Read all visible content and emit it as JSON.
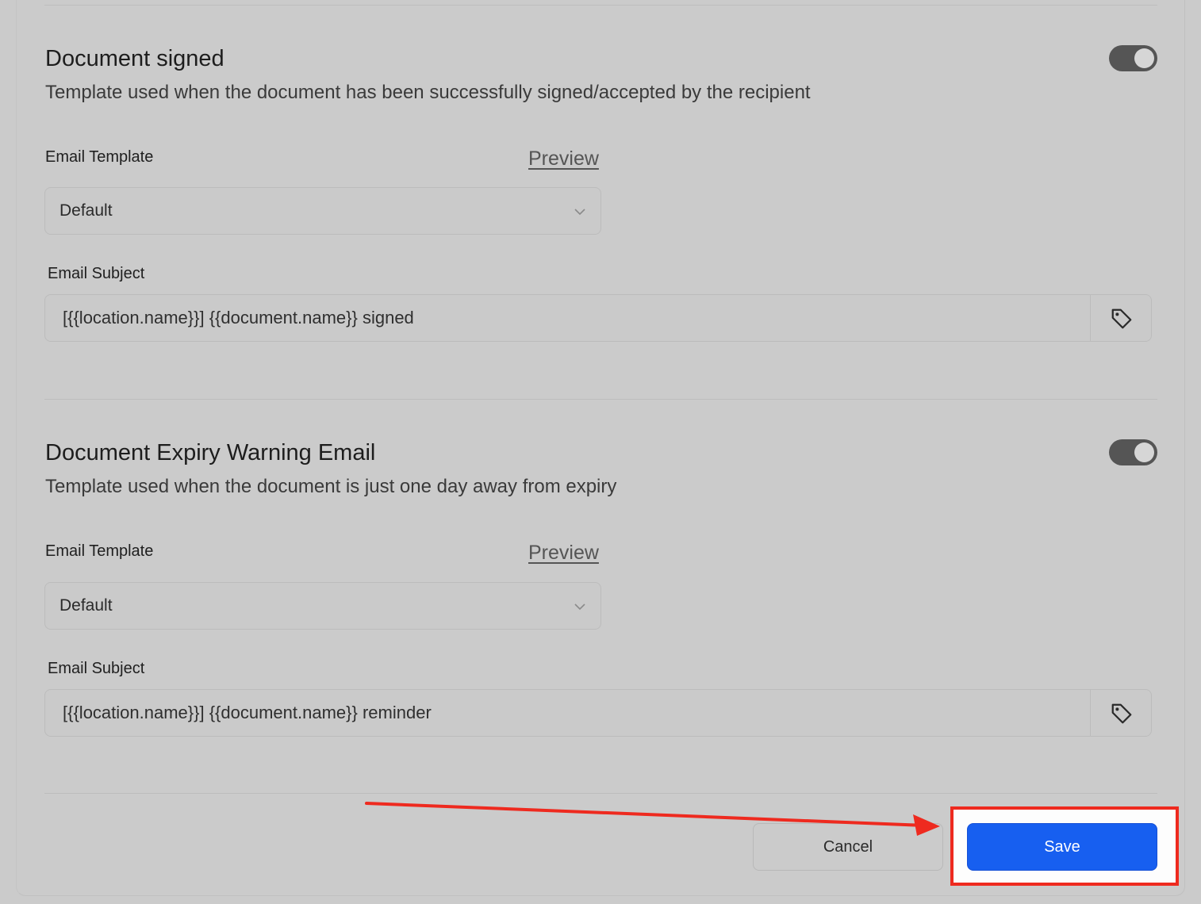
{
  "sections": [
    {
      "title": "Document signed",
      "description": "Template used when the document has been successfully signed/accepted by the recipient",
      "toggle_on": true,
      "email_template_label": "Email Template",
      "preview_label": "Preview",
      "template_value": "Default",
      "email_subject_label": "Email Subject",
      "subject_value": "[{{location.name}}] {{document.name}} signed"
    },
    {
      "title": "Document Expiry Warning Email",
      "description": "Template used when the document is just one day away from expiry",
      "toggle_on": true,
      "email_template_label": "Email Template",
      "preview_label": "Preview",
      "template_value": "Default",
      "email_subject_label": "Email Subject",
      "subject_value": "[{{location.name}}] {{document.name}} reminder"
    }
  ],
  "footer": {
    "cancel_label": "Cancel",
    "save_label": "Save"
  },
  "colors": {
    "save_button": "#175ff0",
    "annotation_red": "#ee2a1f",
    "toggle_track": "#555555"
  },
  "icons": {
    "tag": "tag-icon",
    "chevron": "chevron-down-icon"
  }
}
